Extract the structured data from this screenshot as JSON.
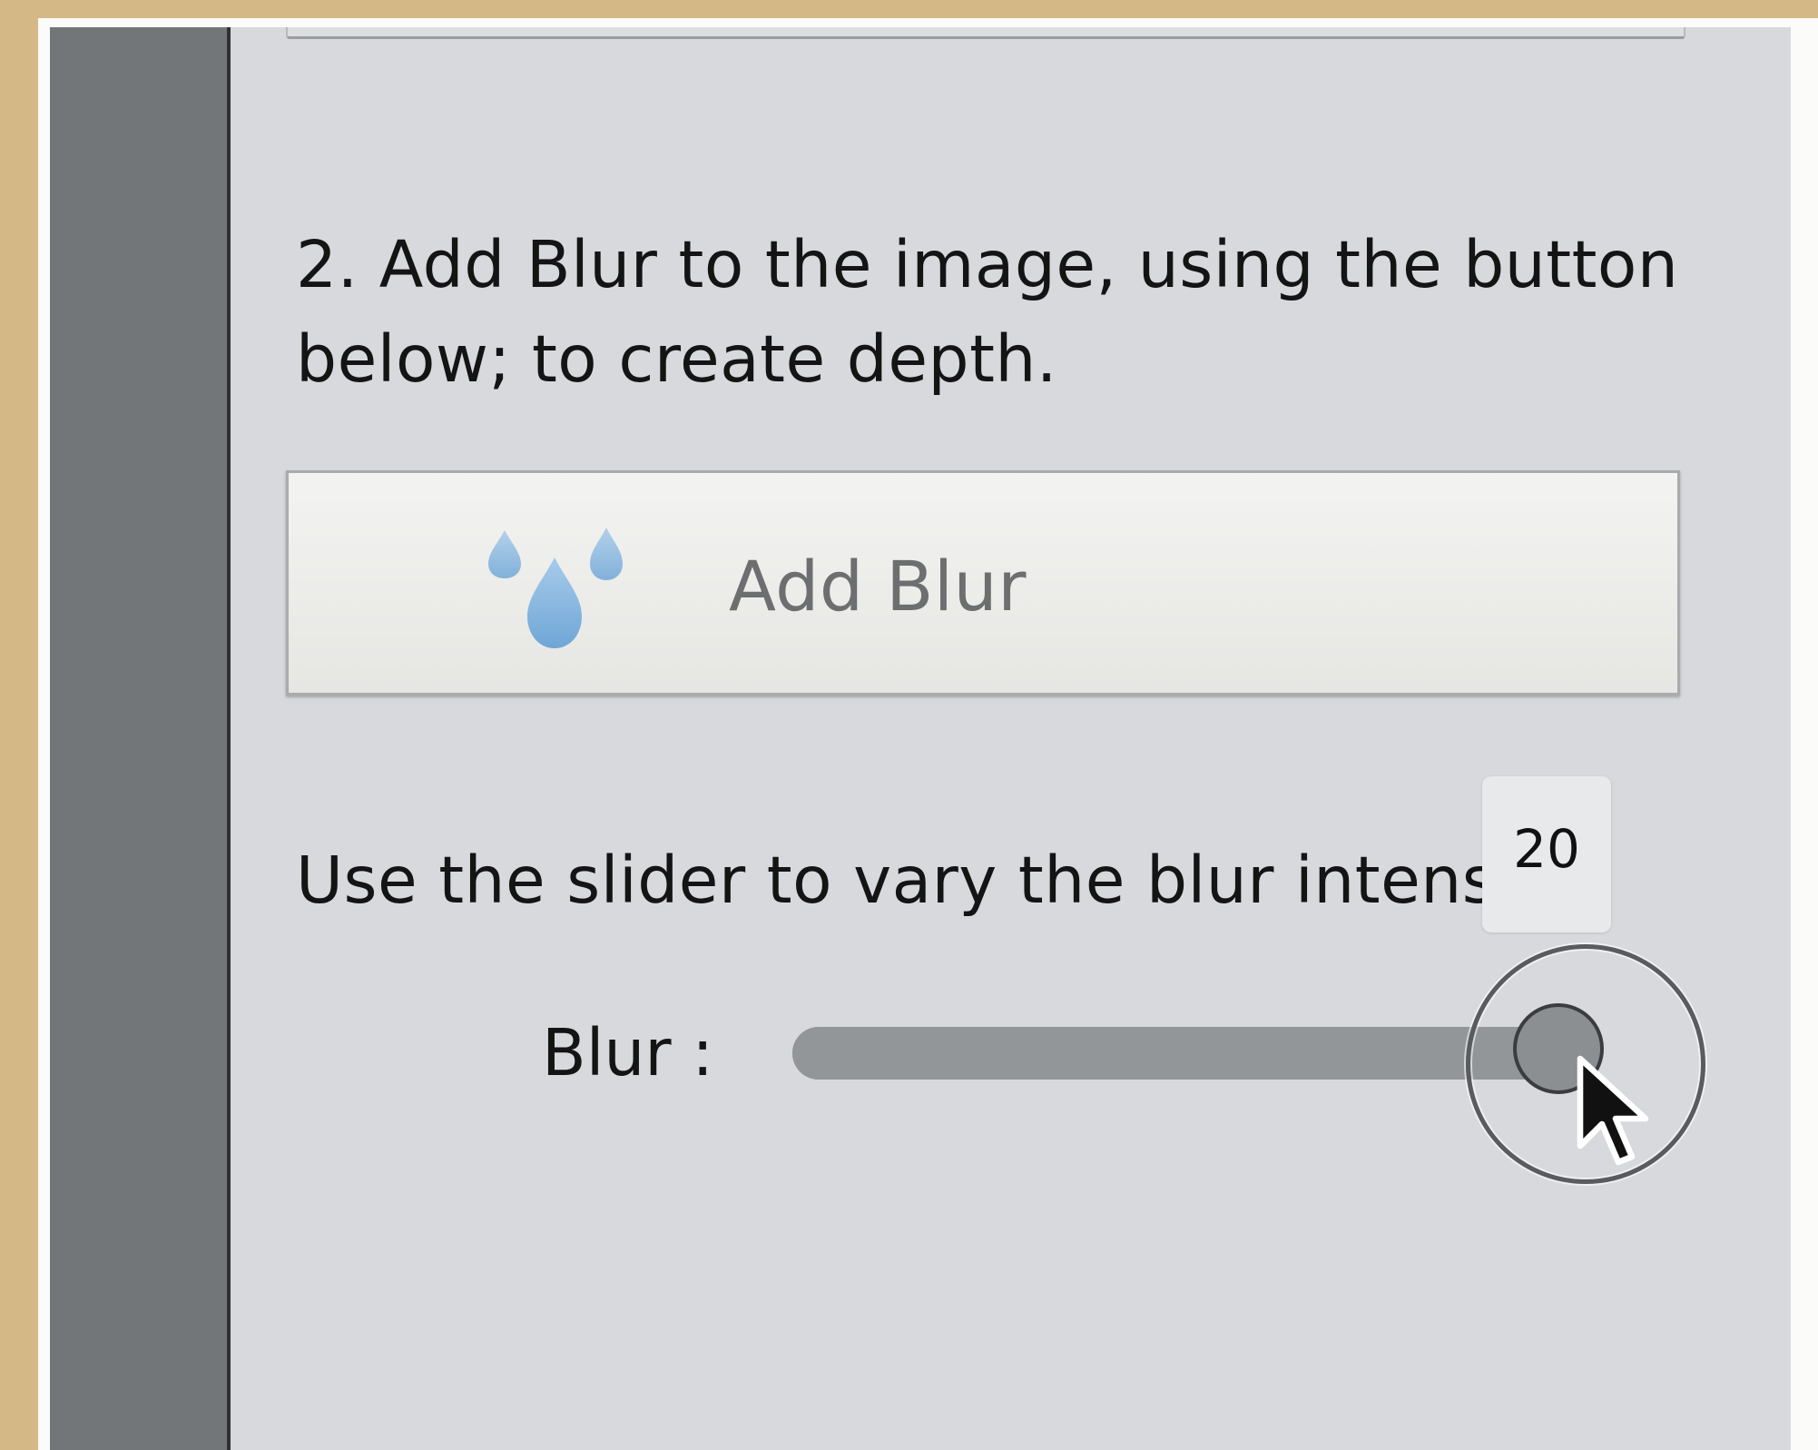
{
  "instructions": {
    "step_text": "2. Add Blur to the image, using the button below; to create depth.",
    "slider_hint": "Use the slider to vary the blur intensity."
  },
  "add_blur_button": {
    "label": "Add Blur",
    "icon": "water-drops-icon",
    "icon_color": "#7fb0dc"
  },
  "blur_slider": {
    "label": "Blur :",
    "value": 20,
    "value_text": "20",
    "position_fraction": 1.0
  },
  "colors": {
    "background_frame": "#d4b987",
    "panel": "#d7d9dc",
    "sidebar": "#737679",
    "slider_track": "#939699"
  }
}
